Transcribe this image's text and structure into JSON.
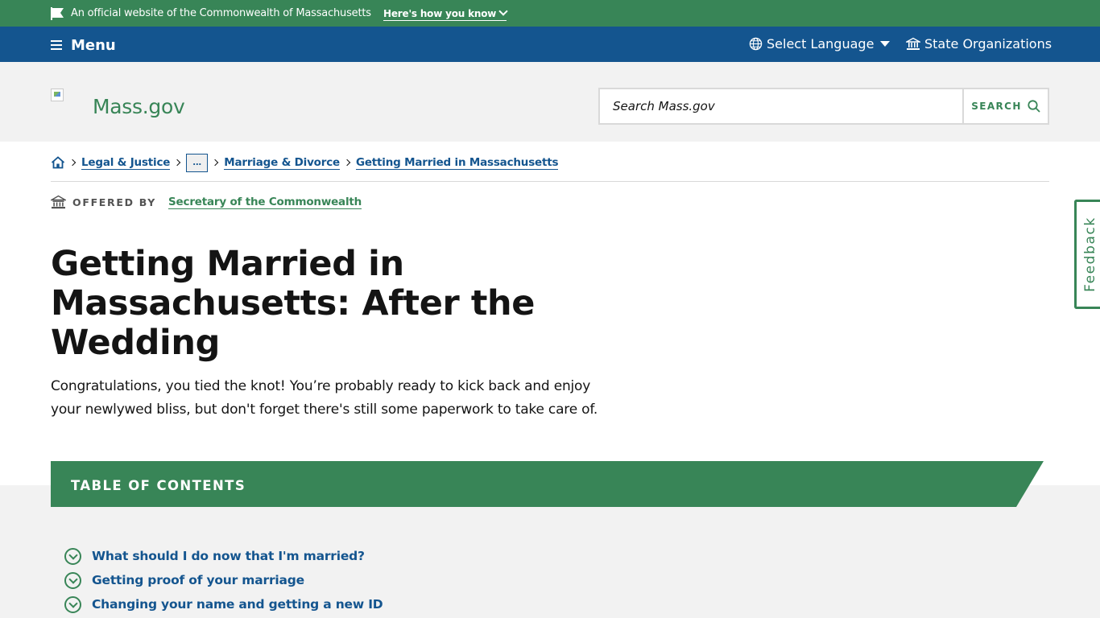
{
  "official_banner": {
    "text": "An official website of the Commonwealth of Massachusetts",
    "how_link": "Here's how you know"
  },
  "nav": {
    "menu_label": "Menu",
    "language_label": "Select Language",
    "orgs_label": "State Organizations"
  },
  "header": {
    "site_name": "Mass.gov",
    "search_placeholder": "Search Mass.gov",
    "search_button": "SEARCH"
  },
  "breadcrumb": {
    "items": [
      "Legal & Justice",
      "...",
      "Marriage & Divorce",
      "Getting Married in Massachusetts"
    ]
  },
  "offered_by": {
    "label": "OFFERED BY",
    "org": "Secretary of the Commonwealth"
  },
  "page": {
    "title": "Getting Married in Massachusetts: After the Wedding",
    "lede": "Congratulations, you tied the knot! You’re probably ready to kick back and enjoy your newlywed bliss, but don't forget there's still some paperwork to take care of."
  },
  "feedback": {
    "label": "Feedback"
  },
  "toc": {
    "title": "TABLE OF CONTENTS",
    "items": [
      "What should I do now that I'm married?",
      "Getting proof of your marriage",
      "Changing your name and getting a new ID"
    ]
  },
  "colors": {
    "green": "#388557",
    "blue": "#14558f",
    "header_bg": "#f2f2f2"
  },
  "icons": [
    "flag-icon",
    "hamburger-icon",
    "globe-icon",
    "building-icon",
    "search-icon",
    "home-icon",
    "capitol-icon",
    "chevron-down-circle-icon"
  ]
}
